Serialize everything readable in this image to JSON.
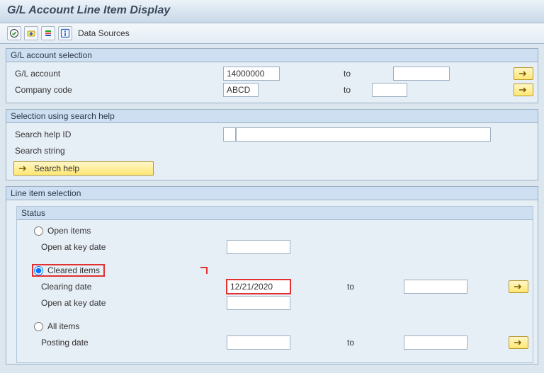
{
  "title": "G/L Account Line Item Display",
  "toolbar": {
    "data_sources": "Data Sources"
  },
  "group_gl": {
    "title": "G/L account selection",
    "gl_account_label": "G/L account",
    "gl_account_value": "14000000",
    "to": "to",
    "company_code_label": "Company code",
    "company_code_value": "ABCD"
  },
  "group_search": {
    "title": "Selection using search help",
    "help_id_label": "Search help ID",
    "search_string_label": "Search string",
    "search_help_btn": "Search help"
  },
  "group_line": {
    "title": "Line item selection",
    "status_title": "Status",
    "open_items": "Open items",
    "open_at_key_date": "Open at key date",
    "cleared_items": "Cleared items",
    "clearing_date": "Clearing date",
    "clearing_date_value": "12/21/2020",
    "all_items": "All items",
    "posting_date": "Posting date",
    "to": "to"
  }
}
